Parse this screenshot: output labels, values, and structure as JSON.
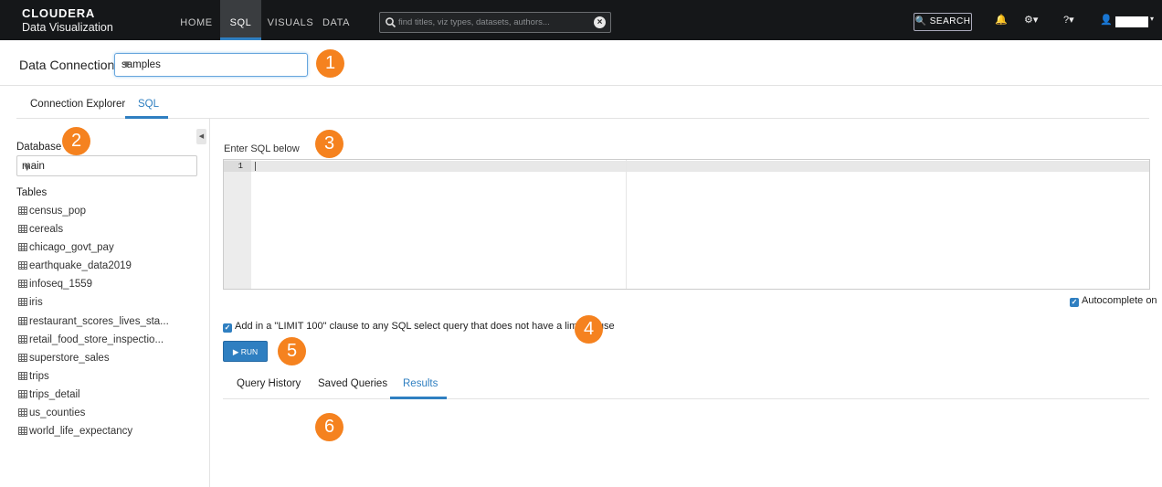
{
  "brand": {
    "name": "CLOUDERA",
    "subtitle": "Data Visualization"
  },
  "nav": {
    "items": [
      "HOME",
      "SQL",
      "VISUALS",
      "DATA"
    ],
    "active": "SQL"
  },
  "topsearch": {
    "placeholder": "find titles, viz types, datasets, authors..."
  },
  "search_button": "SEARCH",
  "data_connection": {
    "label": "Data Connection",
    "value": "samples"
  },
  "tabs": {
    "items": [
      "Connection Explorer",
      "SQL"
    ],
    "active": "SQL"
  },
  "database": {
    "label": "Database",
    "value": "main"
  },
  "tables": {
    "label": "Tables",
    "items": [
      "census_pop",
      "cereals",
      "chicago_govt_pay",
      "earthquake_data2019",
      "infoseq_1559",
      "iris",
      "restaurant_scores_lives_sta...",
      "retail_food_store_inspectio...",
      "superstore_sales",
      "trips",
      "trips_detail",
      "us_counties",
      "world_life_expectancy"
    ]
  },
  "editor": {
    "label": "Enter SQL below",
    "line_number": "1"
  },
  "autocomplete": {
    "label": "Autocomplete on",
    "checked": true
  },
  "limit_option": {
    "label": "Add in a \"LIMIT 100\" clause to any SQL select query that does not have a limit clause",
    "checked": true
  },
  "run_button": "RUN",
  "bottom_tabs": {
    "items": [
      "Query History",
      "Saved Queries",
      "Results"
    ],
    "active": "Results"
  },
  "callouts": [
    "1",
    "2",
    "3",
    "4",
    "5",
    "6"
  ],
  "colors": {
    "accent": "#2f7fc1",
    "callout": "#f5821f",
    "topbar": "#151719"
  }
}
